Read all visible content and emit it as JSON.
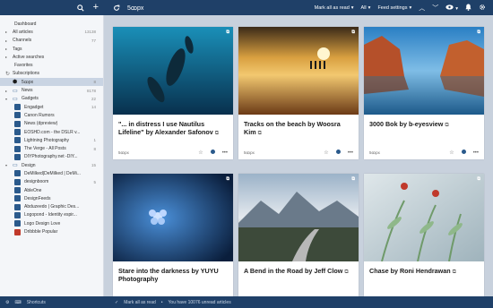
{
  "topbar": {
    "feed_title": "5ꝏpx",
    "mark_all_label": "Mark all as read",
    "filter_label": "All",
    "feed_settings_label": "Feed settings"
  },
  "sidebar": {
    "top_items": [
      {
        "label": "Dashboard",
        "count": ""
      },
      {
        "label": "All articles",
        "count": "13138"
      },
      {
        "label": "Channels",
        "count": "77"
      },
      {
        "label": "Tags",
        "count": ""
      },
      {
        "label": "Active searches",
        "count": ""
      },
      {
        "label": "Favorites",
        "count": ""
      }
    ],
    "subscriptions_label": "Subscriptions",
    "feeds": [
      {
        "label": "5ꝏpx",
        "count": "8",
        "selected": true,
        "level": 0
      },
      {
        "label": "News",
        "count": "8178",
        "level": 0,
        "group": true
      },
      {
        "label": "Gadgets",
        "count": "22",
        "level": 0,
        "group": true,
        "open": true
      },
      {
        "label": "Engadget",
        "count": "14",
        "level": 1
      },
      {
        "label": "Canon Rumors",
        "count": "",
        "level": 1
      },
      {
        "label": "News (dpreview)",
        "count": "",
        "level": 1
      },
      {
        "label": "EOSHD.com - the DSLR v...",
        "count": "",
        "level": 1
      },
      {
        "label": "Lightning Photography",
        "count": "1",
        "level": 1
      },
      {
        "label": "The Verge - All Posts",
        "count": "8",
        "level": 1
      },
      {
        "label": "DIYPhotography.net -DIY...",
        "count": "",
        "level": 1
      },
      {
        "label": "Design",
        "count": "15",
        "level": 0,
        "group": true,
        "open": true
      },
      {
        "label": "DeMilked|DeMilked | DeMi...",
        "count": "",
        "level": 1
      },
      {
        "label": "designboom",
        "count": "5",
        "level": 1
      },
      {
        "label": "AbleOne",
        "count": "",
        "level": 1
      },
      {
        "label": "DesignFeeds",
        "count": "",
        "level": 1
      },
      {
        "label": "Abduzeedo | Graphic Des...",
        "count": "",
        "level": 1
      },
      {
        "label": "Logopond - Identity espir...",
        "count": "",
        "level": 1
      },
      {
        "label": "Logo Design Love",
        "count": "",
        "level": 1
      },
      {
        "label": "Dribbble Popular",
        "count": "",
        "level": 1
      }
    ]
  },
  "cards": [
    {
      "title": "\"... in distress I use Nautilus Lifeline\" by Alexander Safonov",
      "source": "5ꝏpx"
    },
    {
      "title": "Tracks on the beach by Woosra Kim",
      "source": "5ꝏpx"
    },
    {
      "title": "3000 Bok by b-eyesview",
      "source": "5ꝏpx"
    },
    {
      "title": "Stare into the darkness by YUYU Photography",
      "source": ""
    },
    {
      "title": "A Bend in the Road by Jeff Clow",
      "source": ""
    },
    {
      "title": "Chase by Roni Hendrawan",
      "source": ""
    }
  ],
  "bottombar": {
    "shortcuts_label": "Shortcuts",
    "mark_all_label": "Mark all as read",
    "unread_text": "You have 10076 unread articles"
  },
  "colors": {
    "accent": "#1f4068",
    "content_bg": "#c8d1dd"
  }
}
